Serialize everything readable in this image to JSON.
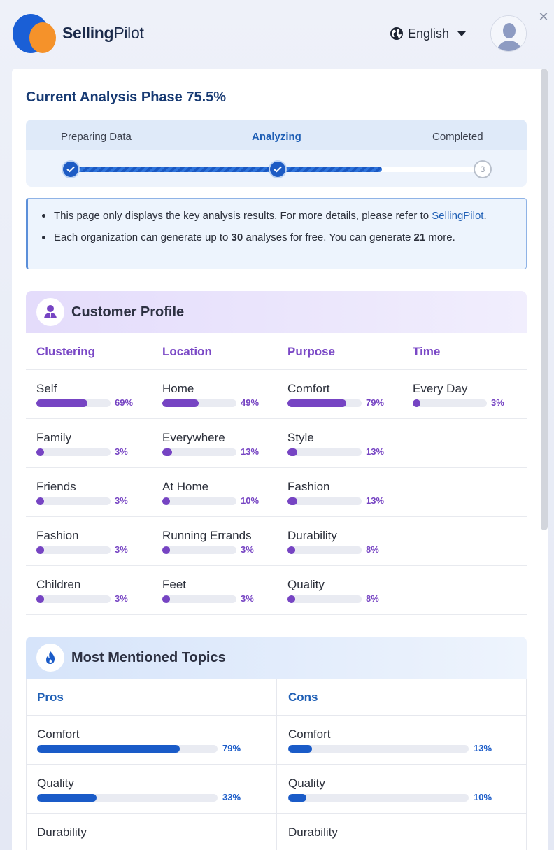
{
  "brand": {
    "bold": "Selling",
    "light": "Pilot"
  },
  "language": {
    "selected": "English"
  },
  "phase": {
    "title": "Current Analysis Phase 75.5%",
    "progress_pct": 75.5
  },
  "steps": [
    {
      "label": "Preparing Data",
      "status": "done"
    },
    {
      "label": "Analyzing",
      "status": "active"
    },
    {
      "label": "Completed",
      "status": "pending",
      "number": "3"
    }
  ],
  "notice": {
    "line1_text": "This page only displays the key analysis results. For more details, please refer to",
    "line1_link": "SellingPilot",
    "line1_end": ".",
    "line2_a": "Each organization can generate up to ",
    "line2_b": "30",
    "line2_c": " analyses for free. You can generate ",
    "line2_d": "21",
    "line2_e": " more."
  },
  "customer_profile": {
    "title": "Customer Profile",
    "columns": [
      {
        "header": "Clustering",
        "items": [
          {
            "name": "Self",
            "pct": 69,
            "label": "69%"
          },
          {
            "name": "Family",
            "pct": 3,
            "label": "3%"
          },
          {
            "name": "Friends",
            "pct": 3,
            "label": "3%"
          },
          {
            "name": "Fashion",
            "pct": 3,
            "label": "3%"
          },
          {
            "name": "Children",
            "pct": 3,
            "label": "3%"
          }
        ]
      },
      {
        "header": "Location",
        "items": [
          {
            "name": "Home",
            "pct": 49,
            "label": "49%"
          },
          {
            "name": "Everywhere",
            "pct": 13,
            "label": "13%"
          },
          {
            "name": "At Home",
            "pct": 10,
            "label": "10%"
          },
          {
            "name": "Running Errands",
            "pct": 3,
            "label": "3%"
          },
          {
            "name": "Feet",
            "pct": 3,
            "label": "3%"
          }
        ]
      },
      {
        "header": "Purpose",
        "items": [
          {
            "name": "Comfort",
            "pct": 79,
            "label": "79%"
          },
          {
            "name": "Style",
            "pct": 13,
            "label": "13%"
          },
          {
            "name": "Fashion",
            "pct": 13,
            "label": "13%"
          },
          {
            "name": "Durability",
            "pct": 8,
            "label": "8%"
          },
          {
            "name": "Quality",
            "pct": 8,
            "label": "8%"
          }
        ]
      },
      {
        "header": "Time",
        "items": [
          {
            "name": "Every Day",
            "pct": 3,
            "label": "3%"
          }
        ]
      }
    ]
  },
  "topics": {
    "title": "Most Mentioned Topics",
    "pros": {
      "header": "Pros",
      "items": [
        {
          "name": "Comfort",
          "pct": 79,
          "label": "79%"
        },
        {
          "name": "Quality",
          "pct": 33,
          "label": "33%"
        },
        {
          "name": "Durability",
          "pct": 0,
          "label": ""
        }
      ]
    },
    "cons": {
      "header": "Cons",
      "items": [
        {
          "name": "Comfort",
          "pct": 13,
          "label": "13%"
        },
        {
          "name": "Quality",
          "pct": 10,
          "label": "10%"
        },
        {
          "name": "Durability",
          "pct": 0,
          "label": ""
        }
      ]
    }
  },
  "colors": {
    "accent_blue": "#1a5bc8",
    "accent_purple": "#7644c3",
    "brand_orange": "#f5922a"
  }
}
